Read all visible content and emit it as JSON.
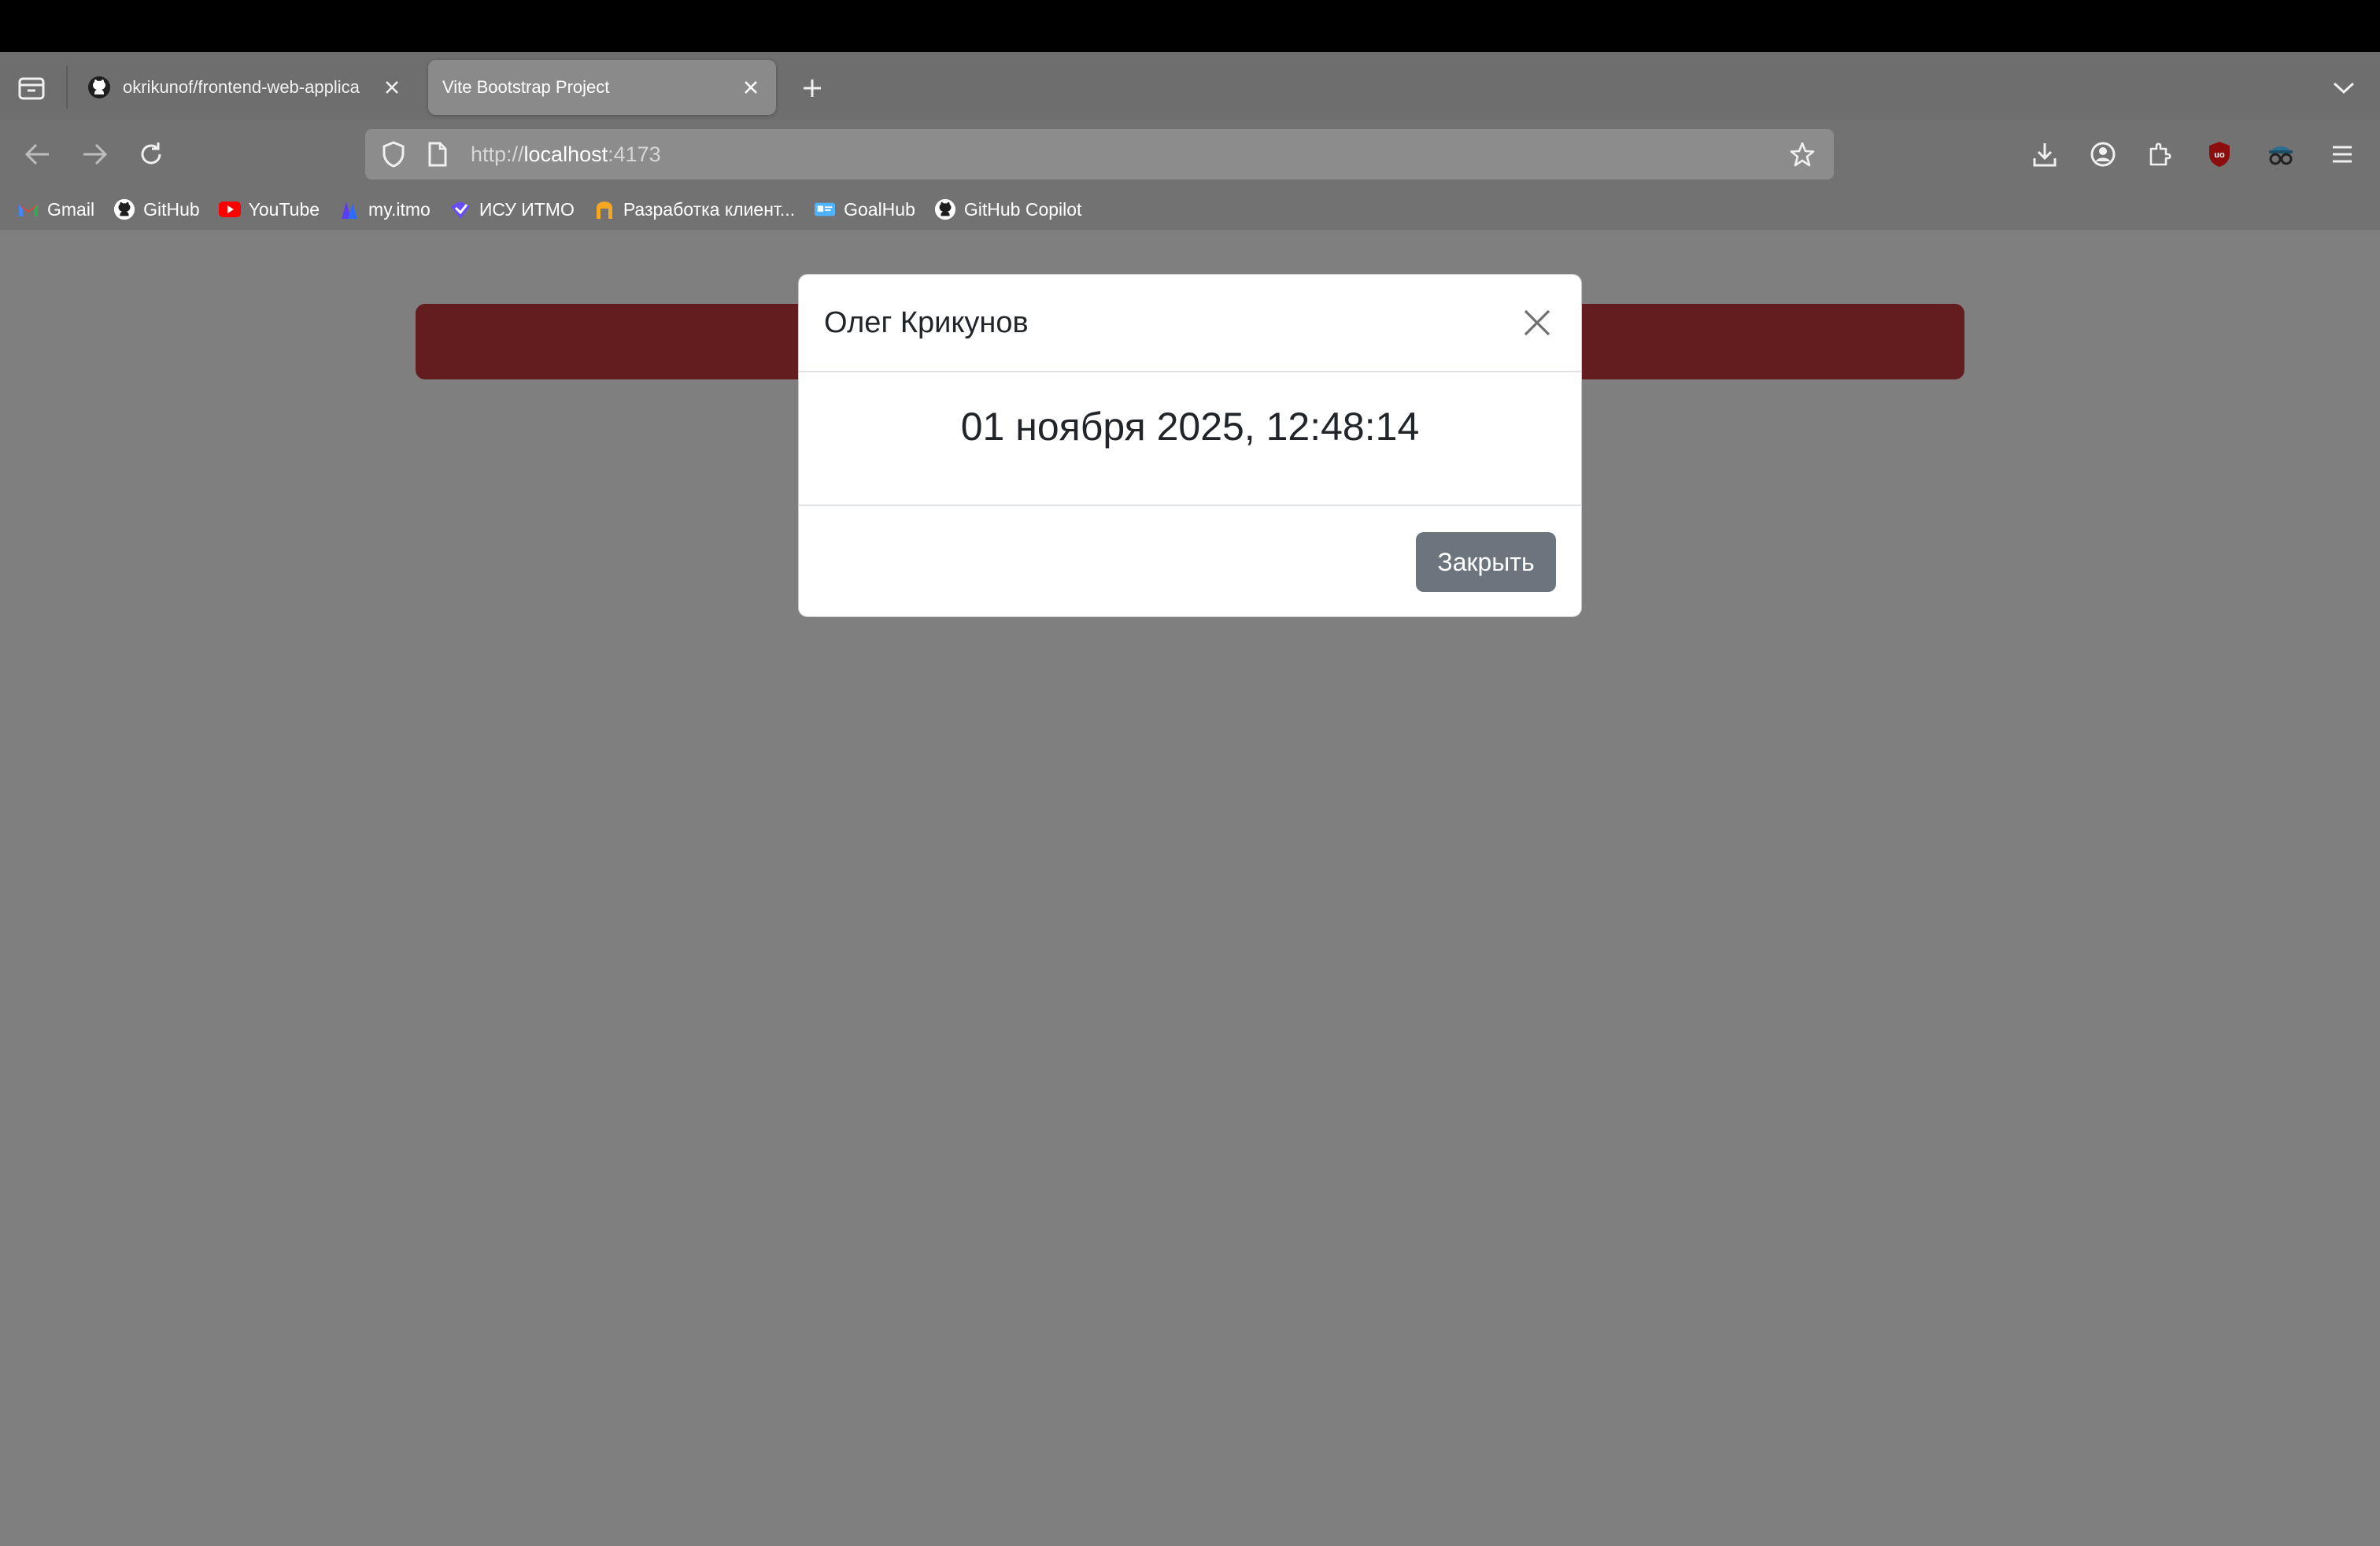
{
  "browser": {
    "tabs": [
      {
        "title": "okrikunof/frontend-web-applica",
        "favicon": "github-icon",
        "active": false
      },
      {
        "title": "Vite Bootstrap Project",
        "favicon": null,
        "active": true
      }
    ],
    "url": {
      "scheme": "http://",
      "host": "localhost",
      "port": ":4173"
    },
    "bookmarks": [
      {
        "label": "Gmail",
        "icon": "gmail-icon"
      },
      {
        "label": "GitHub",
        "icon": "github-icon"
      },
      {
        "label": "YouTube",
        "icon": "youtube-icon"
      },
      {
        "label": "my.itmo",
        "icon": "itmo-icon"
      },
      {
        "label": "ИСУ ИТМО",
        "icon": "isu-icon"
      },
      {
        "label": "Разработка клиент...",
        "icon": "dev-icon"
      },
      {
        "label": "GoalHub",
        "icon": "goalhub-icon"
      },
      {
        "label": "GitHub Copilot",
        "icon": "github-icon"
      }
    ]
  },
  "page": {
    "alert_color": "#c93a3f",
    "backdrop_opacity": 0.5
  },
  "modal": {
    "title": "Олег Крикунов",
    "datetime": "01 ноября 2025, 12:48:14",
    "close_button_label": "Закрыть"
  },
  "colors": {
    "button_secondary": "#6c757d",
    "chrome_bg": "#727272",
    "url_bg": "#8c8c8c"
  }
}
